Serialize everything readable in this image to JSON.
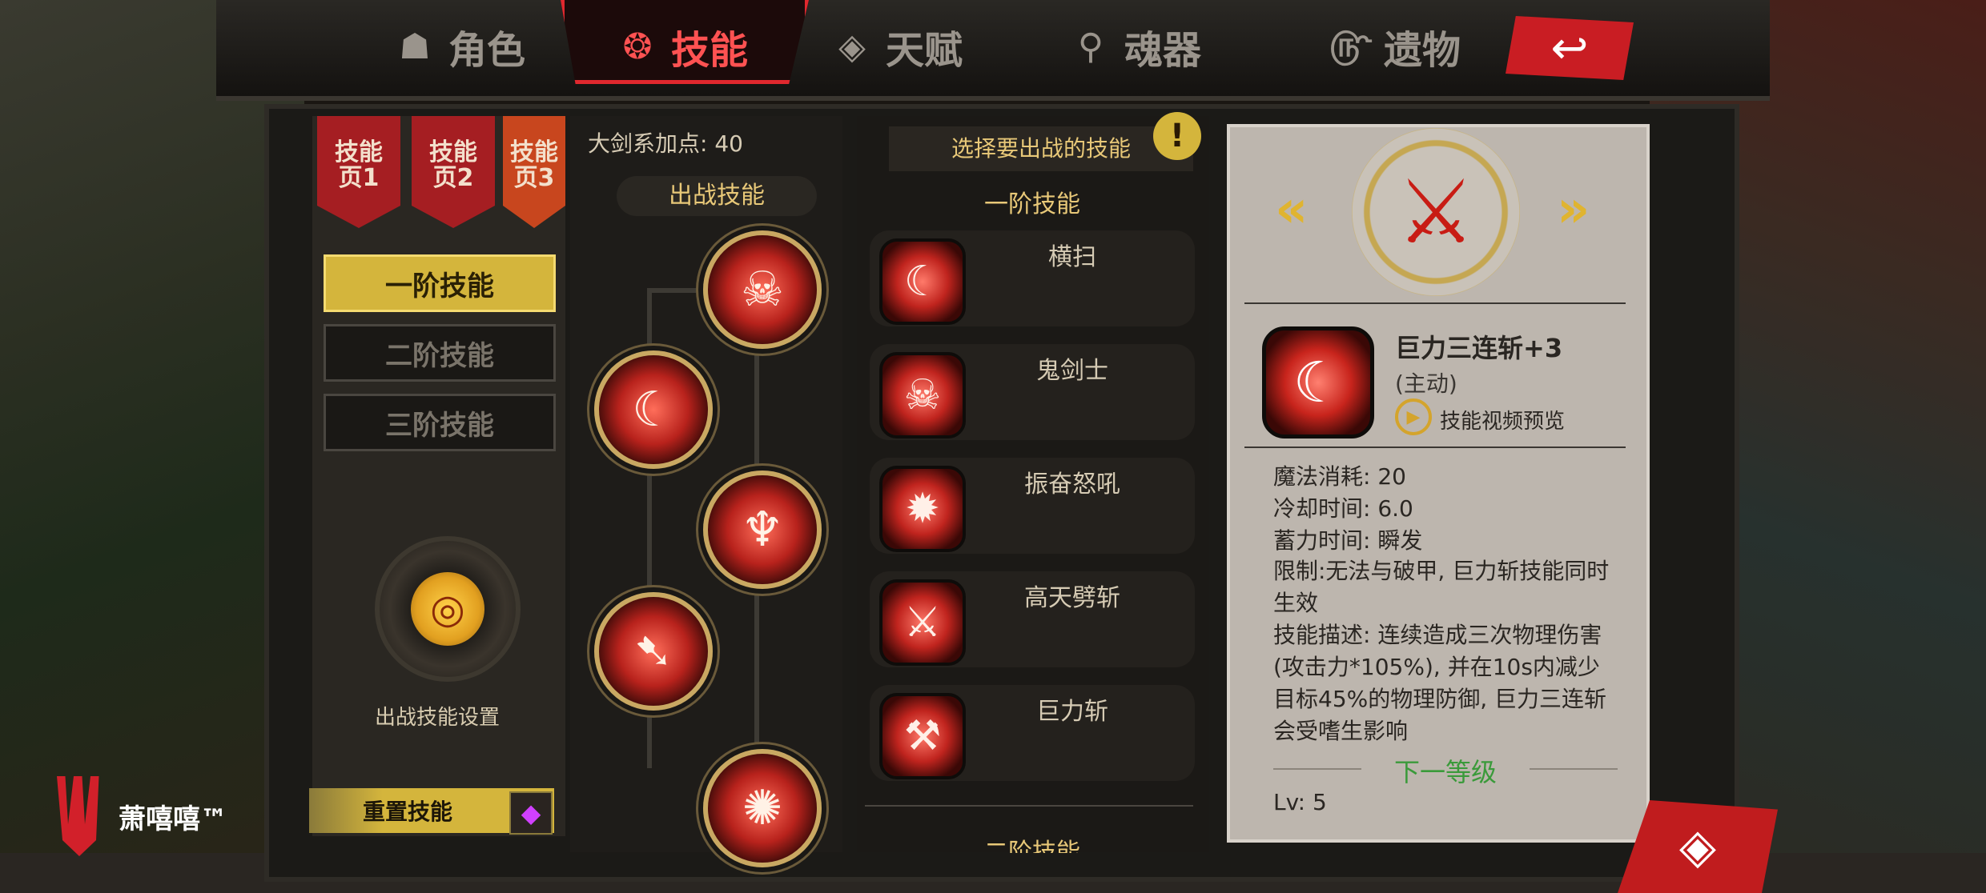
{
  "tabs": [
    {
      "label": "角色",
      "icon": "demon-mask-icon",
      "active": false
    },
    {
      "label": "技能",
      "icon": "skill-swirl-icon",
      "active": true
    },
    {
      "label": "天赋",
      "icon": "diamond-wing-icon",
      "active": false
    },
    {
      "label": "魂器",
      "icon": "soul-orb-icon",
      "active": false
    },
    {
      "label": "遗物",
      "icon": "relic-spiral-icon",
      "active": false
    }
  ],
  "skill_pages": [
    {
      "label": "技能\n页1"
    },
    {
      "label": "技能\n页2"
    },
    {
      "label": "技能\n页3"
    }
  ],
  "tiers": [
    {
      "label": "一阶技能",
      "active": true
    },
    {
      "label": "二阶技能",
      "active": false
    },
    {
      "label": "三阶技能",
      "active": false
    }
  ],
  "battle_setting_label": "出战技能设置",
  "reset_label": "重置技能",
  "points_label": "大剑系加点: 40",
  "battle_skills_title": "出战技能",
  "select_hint": "选择要出战的技能",
  "tier1_header": "一阶技能",
  "tier2_header": "二阶技能",
  "tier1_skills": [
    {
      "name": "横扫",
      "icon": "slash-arc-icon"
    },
    {
      "name": "鬼剑士",
      "icon": "demon-face-icon"
    },
    {
      "name": "振奋怒吼",
      "icon": "roar-icon"
    },
    {
      "name": "高天劈斩",
      "icon": "sky-chop-icon"
    },
    {
      "name": "巨力斩",
      "icon": "heavy-slash-icon"
    }
  ],
  "detail": {
    "name": "巨力三连斩+3",
    "type": "(主动)",
    "video_label": "技能视频预览",
    "mana": "魔法消耗: 20",
    "cooldown": "冷却时间: 6.0",
    "charge": "蓄力时间: 瞬发",
    "limit": "限制:无法与破甲, 巨力斩技能同时生效",
    "desc": "技能描述: 连续造成三次物理伤害(攻击力*105%), 并在10s内减少目标45%的物理防御, 巨力三连斩会受嗜生影响",
    "next_level": "下一等级",
    "lv": "Lv: 5"
  },
  "brand": "萧嘻嘻™",
  "colors": {
    "accent_red": "#e0282e",
    "gold": "#d4b53c",
    "green": "#3a9a3a"
  }
}
